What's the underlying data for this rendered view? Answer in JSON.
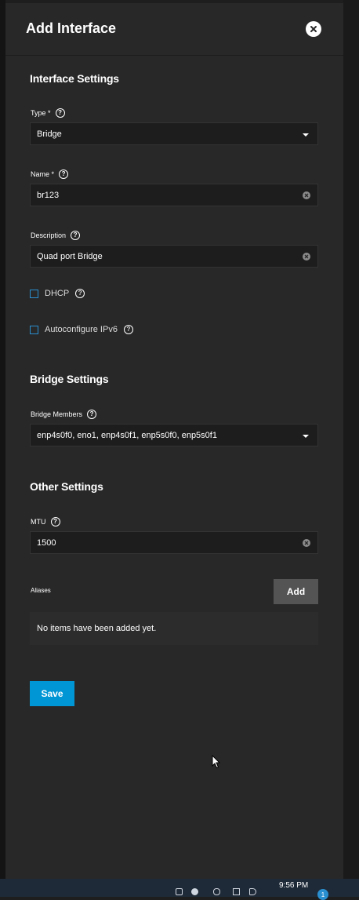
{
  "dialog": {
    "title": "Add Interface"
  },
  "interface_settings": {
    "heading": "Interface Settings",
    "type": {
      "label": "Type *",
      "value": "Bridge"
    },
    "name": {
      "label": "Name *",
      "value": "br123"
    },
    "description": {
      "label": "Description",
      "value": "Quad port Bridge"
    },
    "dhcp": {
      "label": "DHCP",
      "checked": false
    },
    "autoconfig_ipv6": {
      "label": "Autoconfigure IPv6",
      "checked": false
    }
  },
  "bridge_settings": {
    "heading": "Bridge Settings",
    "members": {
      "label": "Bridge Members",
      "value": "enp4s0f0, eno1, enp4s0f1, enp5s0f0, enp5s0f1"
    }
  },
  "other_settings": {
    "heading": "Other Settings",
    "mtu": {
      "label": "MTU",
      "value": "1500"
    },
    "aliases": {
      "label": "Aliases",
      "add_label": "Add",
      "empty_text": "No items have been added yet."
    }
  },
  "actions": {
    "save_label": "Save"
  },
  "taskbar": {
    "time": "9:56 PM",
    "notifications": "1"
  },
  "colors": {
    "accent": "#0095d5",
    "panel": "#282828",
    "field": "#1d1d1d"
  }
}
